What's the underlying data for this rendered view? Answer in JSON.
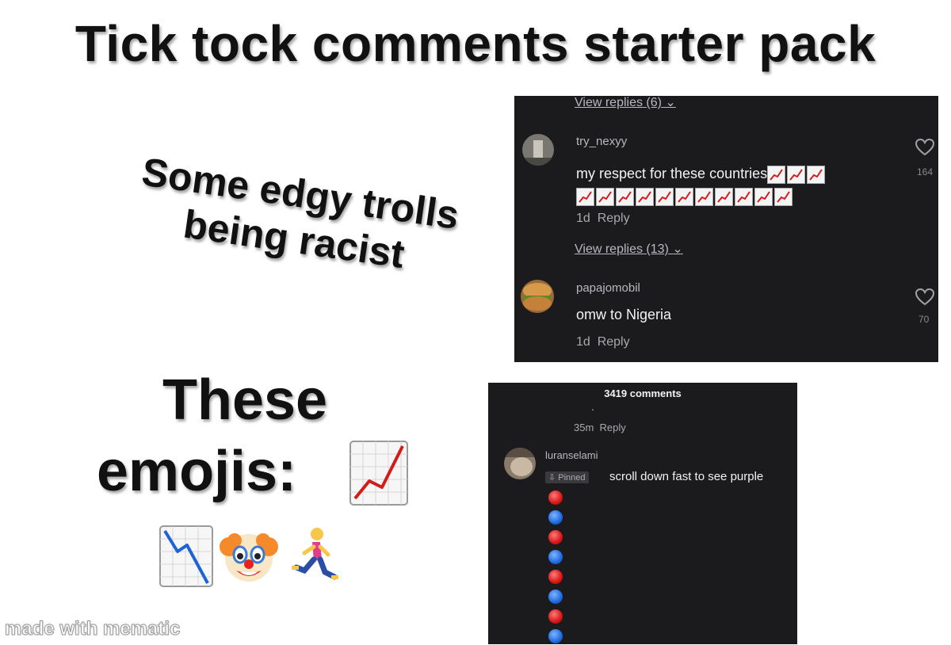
{
  "title": "Tick tock comments starter pack",
  "caption_trolls": {
    "line1": "Some edgy trolls",
    "line2": "being racist"
  },
  "caption_emojis": {
    "line1": "These",
    "line2": "emojis:"
  },
  "emojis": [
    "chart-increasing-icon",
    "chart-decreasing-icon",
    "clown-face-icon",
    "person-running-icon"
  ],
  "watermark": "made with mematic",
  "screenshot1": {
    "view_replies_top": "View replies (6)",
    "comment1": {
      "username": "try_nexyy",
      "text": "my respect for these countries",
      "time": "1d",
      "reply": "Reply",
      "likes": "164"
    },
    "view_replies_mid": "View replies (13)",
    "comment2": {
      "username": "papajomobil",
      "text": "omw to Nigeria",
      "time": "1d",
      "reply": "Reply",
      "likes": "70"
    }
  },
  "screenshot2": {
    "comment_count": "3419 comments",
    "dot": ".",
    "prev_time": "35m",
    "prev_reply": "Reply",
    "username": "luranselami",
    "pinned_label": "Pinned",
    "text": "scroll down fast to see purple",
    "ball_colors": [
      "red",
      "blue",
      "red",
      "blue",
      "red",
      "blue",
      "red",
      "blue"
    ]
  }
}
